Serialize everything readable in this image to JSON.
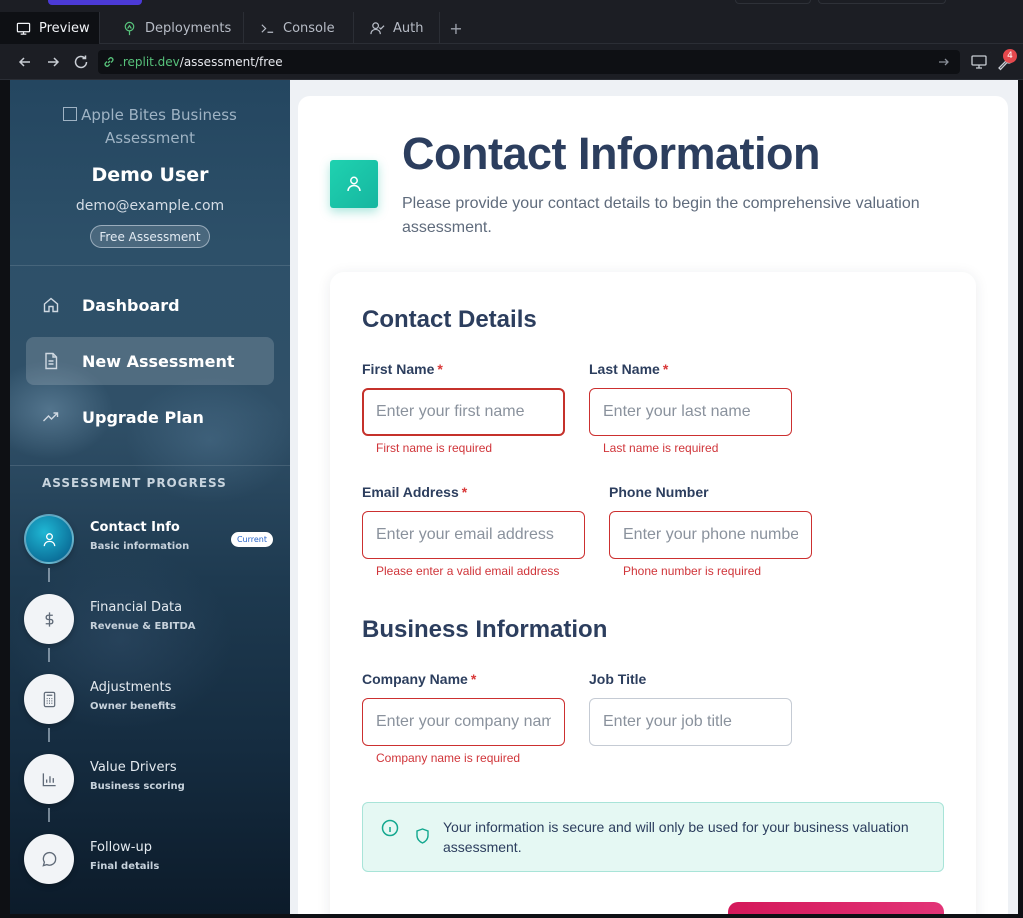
{
  "browser": {
    "tabs": [
      {
        "label": "Preview",
        "icon": "monitor-icon"
      },
      {
        "label": "Deployments",
        "icon": "deploy-icon"
      },
      {
        "label": "Console",
        "icon": "terminal-icon"
      },
      {
        "label": "Auth",
        "icon": "user-check-icon"
      }
    ],
    "new_tab": "+",
    "url_host": ".replit.dev",
    "url_path": "/assessment/free",
    "notification_count": "4"
  },
  "sidebar": {
    "logo_alt": "Apple Bites Business Assessment",
    "user_name": "Demo User",
    "user_email": "demo@example.com",
    "plan_badge": "Free Assessment",
    "nav": [
      {
        "label": "Dashboard",
        "icon": "home-icon",
        "active": false
      },
      {
        "label": "New Assessment",
        "icon": "document-icon",
        "active": true
      },
      {
        "label": "Upgrade Plan",
        "icon": "trending-up-icon",
        "active": false
      }
    ],
    "progress_heading": "ASSESSMENT PROGRESS",
    "steps": [
      {
        "title": "Contact Info",
        "subtitle": "Basic information",
        "badge": "Current",
        "icon": "user-icon"
      },
      {
        "title": "Financial Data",
        "subtitle": "Revenue & EBITDA",
        "icon": "dollar-icon"
      },
      {
        "title": "Adjustments",
        "subtitle": "Owner benefits",
        "icon": "calculator-icon"
      },
      {
        "title": "Value Drivers",
        "subtitle": "Business scoring",
        "icon": "bar-chart-icon"
      },
      {
        "title": "Follow-up",
        "subtitle": "Final details",
        "icon": "message-icon"
      }
    ]
  },
  "main": {
    "title": "Contact Information",
    "subtitle": "Please provide your contact details to begin the comprehensive valuation assessment.",
    "contact_section": "Contact Details",
    "business_section": "Business Information",
    "fields": {
      "first_name": {
        "label": "First Name",
        "required": "*",
        "placeholder": "Enter your first name",
        "error": "First name is required"
      },
      "last_name": {
        "label": "Last Name",
        "required": "*",
        "placeholder": "Enter your last name",
        "error": "Last name is required"
      },
      "email": {
        "label": "Email Address",
        "required": "*",
        "placeholder": "Enter your email address",
        "error": "Please enter a valid email address"
      },
      "phone": {
        "label": "Phone Number",
        "placeholder": "Enter your phone number",
        "error": "Phone number is required"
      },
      "company": {
        "label": "Company Name",
        "required": "*",
        "placeholder": "Enter your company name",
        "error": "Company name is required"
      },
      "job_title": {
        "label": "Job Title",
        "placeholder": "Enter your job title"
      }
    },
    "notice": "Your information is secure and will only be used for your business valuation assessment."
  },
  "colors": {
    "accent_teal": "#16b6a0",
    "error_red": "#cc3030",
    "submit_pink": "#d4185a",
    "heading_navy": "#2c3e5e"
  }
}
